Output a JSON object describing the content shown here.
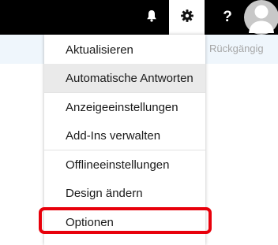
{
  "topbar": {
    "icons": {
      "notifications": "bell-icon",
      "settings": "gear-icon",
      "help": "help-icon",
      "profile": "person-icon"
    },
    "help_label": "?"
  },
  "commandbar": {
    "undo_label": "Rückgängig"
  },
  "settings_menu": {
    "items": [
      {
        "label": "Aktualisieren"
      },
      {
        "label": "Automatische Antworten",
        "selected": true
      },
      {
        "label": "Anzeigeeinstellungen"
      },
      {
        "label": "Add-Ins verwalten"
      },
      {
        "label": "Offlineeinstellungen"
      },
      {
        "label": "Design ändern"
      },
      {
        "label": "Optionen",
        "highlighted": true
      }
    ]
  },
  "colors": {
    "topbar_bg": "#000000",
    "commandbar_bg": "#eff6fc",
    "menu_selected_bg": "#eaeaea",
    "highlight_border": "#e8000b"
  }
}
